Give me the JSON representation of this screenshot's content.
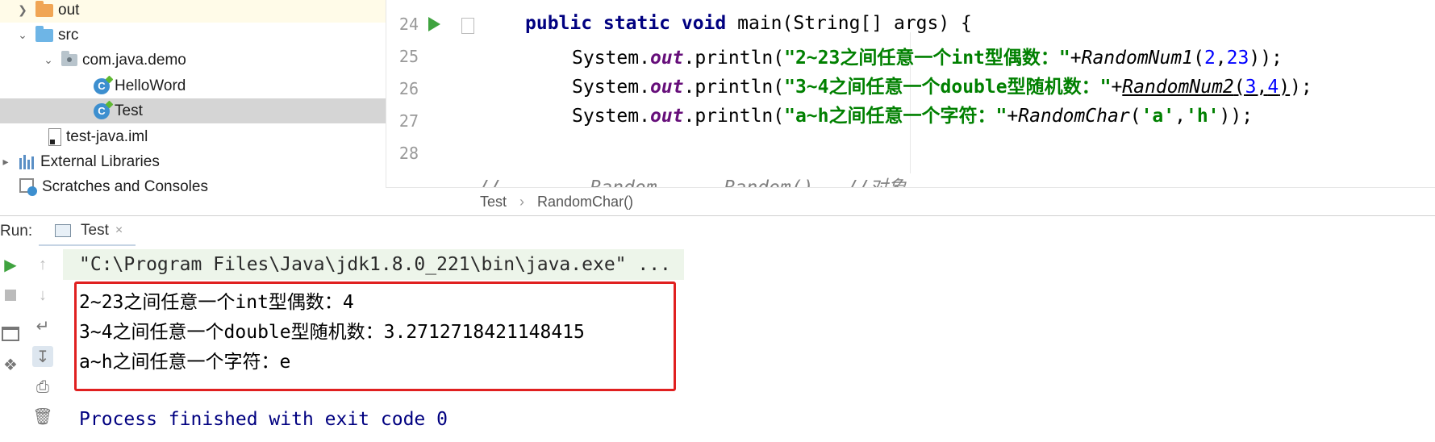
{
  "project_tree": {
    "items": [
      {
        "label": "out",
        "icon": "folder-orange-icon"
      },
      {
        "label": "src",
        "icon": "source-folder-icon"
      },
      {
        "label": "com.java.demo",
        "icon": "package-icon"
      },
      {
        "label": "HelloWord",
        "icon": "java-class-icon"
      },
      {
        "label": "Test",
        "icon": "java-class-icon"
      },
      {
        "label": "test-java.iml",
        "icon": "iml-file-icon"
      },
      {
        "label": "External Libraries",
        "icon": "libraries-icon"
      },
      {
        "label": "Scratches and Consoles",
        "icon": "scratches-icon"
      }
    ]
  },
  "editor": {
    "line_numbers": [
      "24",
      "25",
      "26",
      "27",
      "28"
    ],
    "code": {
      "l24_kw": "public static void ",
      "l24_rest": "main(String[] args) {",
      "sys": "System.",
      "out": "out",
      "println": ".println(",
      "l25_str": "\"2~23之间任意一个int型偶数：\"",
      "l25_call": "RandomNum1",
      "l25_a": "2",
      "l25_b": "23",
      "l26_str": "\"3~4之间任意一个double型随机数：\"",
      "l26_call": "RandomNum2",
      "l26_a": "3",
      "l26_b": "4",
      "l27_str": "\"a~h之间任意一个字符：\"",
      "l27_call": "RandomChar",
      "l27_a": "'a'",
      "l27_b": "'h'",
      "l29_partial": "//        Random      Random()   //对象"
    }
  },
  "breadcrumbs": {
    "class": "Test",
    "separator": "›",
    "method": "RandomChar()"
  },
  "run_panel": {
    "label": "Run:",
    "tab": "Test",
    "close": "×"
  },
  "console": {
    "command": "\"C:\\Program Files\\Java\\jdk1.8.0_221\\bin\\java.exe\" ...",
    "lines": [
      "2~23之间任意一个int型偶数：4",
      "3~4之间任意一个double型随机数：3.2712718421148415",
      "a~h之间任意一个字符：e"
    ],
    "finished": "Process finished with exit code 0"
  },
  "colors": {
    "highlight_box": "#e02020",
    "keyword": "#000080",
    "string": "#008000",
    "number": "#0000ff"
  }
}
